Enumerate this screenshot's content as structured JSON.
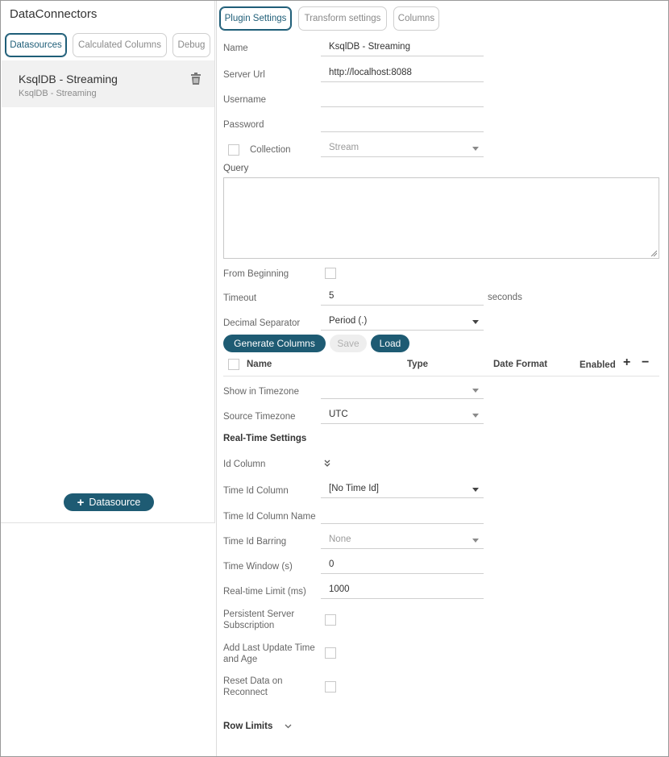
{
  "app": {
    "title": "DataConnectors"
  },
  "left_tabs": [
    {
      "label": "Datasources"
    },
    {
      "label": "Calculated Columns"
    },
    {
      "label": "Debug"
    }
  ],
  "datasource": {
    "name": "KsqlDB - Streaming",
    "subtitle": "KsqlDB - Streaming"
  },
  "add_datasource_label": "Datasource",
  "panel_tabs": [
    {
      "label": "Plugin Settings"
    },
    {
      "label": "Transform settings"
    },
    {
      "label": "Columns"
    }
  ],
  "form": {
    "name": {
      "label": "Name",
      "value": "KsqlDB - Streaming"
    },
    "server_url": {
      "label": "Server Url",
      "value": "http://localhost:8088"
    },
    "username": {
      "label": "Username",
      "value": ""
    },
    "password": {
      "label": "Password",
      "value": ""
    },
    "collection": {
      "label": "Collection",
      "value": "Stream"
    },
    "query": {
      "label": "Query",
      "value": ""
    },
    "from_beginning": {
      "label": "From Beginning"
    },
    "timeout": {
      "label": "Timeout",
      "value": "5",
      "unit": "seconds"
    },
    "decimal_separator": {
      "label": "Decimal Separator",
      "value": "Period (.)"
    }
  },
  "buttons": {
    "generate": "Generate Columns",
    "save": "Save",
    "load": "Load"
  },
  "columns_table": {
    "headers": [
      "Name",
      "Type",
      "Date Format",
      "Enabled"
    ],
    "add": "+",
    "remove": "−"
  },
  "timezone": {
    "show_in": {
      "label": "Show in Timezone",
      "value": ""
    },
    "source": {
      "label": "Source Timezone",
      "value": "UTC"
    }
  },
  "realtime": {
    "heading": "Real-Time Settings",
    "id_column": {
      "label": "Id Column"
    },
    "time_id_column": {
      "label": "Time Id Column",
      "value": "[No Time Id]"
    },
    "time_id_column_name": {
      "label": "Time Id Column Name",
      "value": ""
    },
    "time_id_barring": {
      "label": "Time Id Barring",
      "value": "None"
    },
    "time_window": {
      "label": "Time Window (s)",
      "value": "0"
    },
    "realtime_limit": {
      "label": "Real-time Limit (ms)",
      "value": "1000"
    },
    "persistent": {
      "label_1": "Persistent Server",
      "label_2": "Subscription"
    },
    "last_update": {
      "label_1": "Add Last Update Time",
      "label_2": "and Age"
    },
    "reset": {
      "label_1": "Reset Data on",
      "label_2": "Reconnect"
    }
  },
  "row_limits": {
    "label": "Row Limits"
  },
  "colors": {
    "accent": "#1e5b73"
  }
}
